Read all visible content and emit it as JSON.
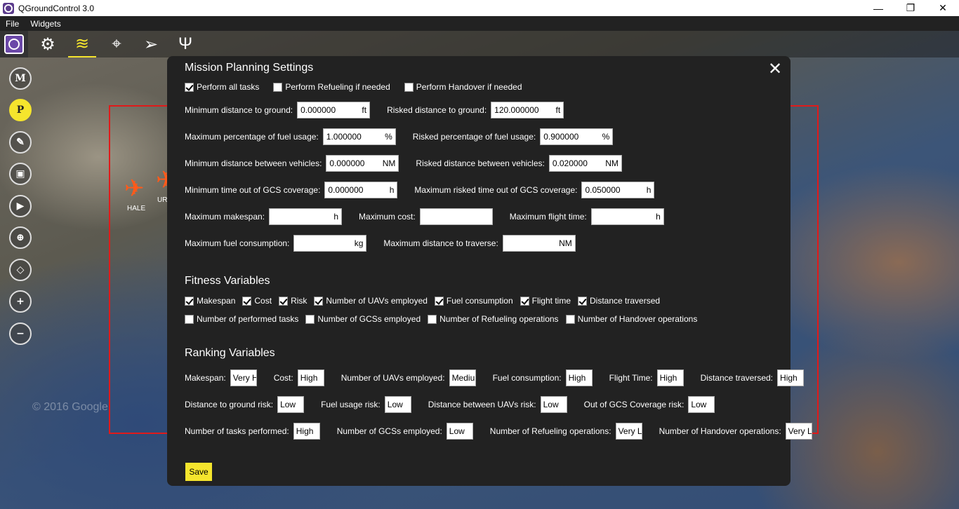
{
  "window": {
    "title": "QGroundControl 3.0",
    "minimize": "—",
    "restore": "❐",
    "close": "✕"
  },
  "menu": {
    "file": "File",
    "widgets": "Widgets"
  },
  "map": {
    "copyright": "© 2016 Google",
    "planes": [
      {
        "label": "HALE"
      },
      {
        "label": "UR"
      }
    ]
  },
  "dialog": {
    "title": "Mission Planning Settings",
    "close": "✕",
    "options": [
      {
        "label": "Perform all tasks",
        "checked": true
      },
      {
        "label": "Perform Refueling if needed",
        "checked": false
      },
      {
        "label": "Perform Handover if needed",
        "checked": false
      }
    ],
    "params": {
      "min_ground": {
        "label": "Minimum distance to ground:",
        "value": "0.000000",
        "unit": "ft"
      },
      "risk_ground": {
        "label": "Risked distance to ground:",
        "value": "120.000000",
        "unit": "ft"
      },
      "max_fuel_pct": {
        "label": "Maximum percentage of fuel usage:",
        "value": "1.000000",
        "unit": "%"
      },
      "risk_fuel_pct": {
        "label": "Risked percentage of fuel usage:",
        "value": "0.900000",
        "unit": "%"
      },
      "min_dist_veh": {
        "label": "Minimum distance between vehicles:",
        "value": "0.000000",
        "unit": "NM"
      },
      "risk_dist_veh": {
        "label": "Risked distance between vehicles:",
        "value": "0.020000",
        "unit": "NM"
      },
      "min_time_gcs": {
        "label": "Minimum time out of GCS coverage:",
        "value": "0.000000",
        "unit": "h"
      },
      "max_risk_time_gcs": {
        "label": "Maximum risked time out of GCS coverage:",
        "value": "0.050000",
        "unit": "h"
      },
      "max_makespan": {
        "label": "Maximum makespan:",
        "value": "",
        "unit": "h"
      },
      "max_cost": {
        "label": "Maximum cost:",
        "value": "",
        "unit": ""
      },
      "max_flight_time": {
        "label": "Maximum flight time:",
        "value": "",
        "unit": "h"
      },
      "max_fuel_cons": {
        "label": "Maximum fuel consumption:",
        "value": "",
        "unit": "kg"
      },
      "max_dist_trav": {
        "label": "Maximum distance to traverse:",
        "value": "",
        "unit": "NM"
      }
    },
    "fitness": {
      "title": "Fitness Variables",
      "row1": [
        {
          "label": "Makespan",
          "checked": true
        },
        {
          "label": "Cost",
          "checked": true
        },
        {
          "label": "Risk",
          "checked": true
        },
        {
          "label": "Number of UAVs employed",
          "checked": true
        },
        {
          "label": "Fuel consumption",
          "checked": true
        },
        {
          "label": "Flight time",
          "checked": true
        },
        {
          "label": "Distance traversed",
          "checked": true
        }
      ],
      "row2": [
        {
          "label": "Number of performed tasks",
          "checked": false
        },
        {
          "label": "Number of GCSs employed",
          "checked": false
        },
        {
          "label": "Number of Refueling operations",
          "checked": false
        },
        {
          "label": "Number of Handover operations",
          "checked": false
        }
      ]
    },
    "ranking": {
      "title": "Ranking Variables",
      "row1": [
        {
          "label": "Makespan:",
          "value": "Very High"
        },
        {
          "label": "Cost:",
          "value": "High"
        },
        {
          "label": "Number of UAVs employed:",
          "value": "Medium"
        },
        {
          "label": "Fuel consumption:",
          "value": "High"
        },
        {
          "label": "Flight Time:",
          "value": "High"
        },
        {
          "label": "Distance traversed:",
          "value": "High"
        }
      ],
      "row2": [
        {
          "label": "Distance to ground risk:",
          "value": "Low"
        },
        {
          "label": "Fuel usage risk:",
          "value": "Low"
        },
        {
          "label": "Distance between UAVs risk:",
          "value": "Low"
        },
        {
          "label": "Out of GCS Coverage risk:",
          "value": "Low"
        }
      ],
      "row3": [
        {
          "label": "Number of tasks performed:",
          "value": "High"
        },
        {
          "label": "Number of GCSs employed:",
          "value": "Low"
        },
        {
          "label": "Number of Refueling operations:",
          "value": "Very Low"
        },
        {
          "label": "Number of Handover operations:",
          "value": "Very Low"
        }
      ]
    },
    "save_label": "Save"
  },
  "colors": {
    "accent": "#f5e52d",
    "dialog_bg": "#222222",
    "mission_border": "#e01a1a"
  }
}
